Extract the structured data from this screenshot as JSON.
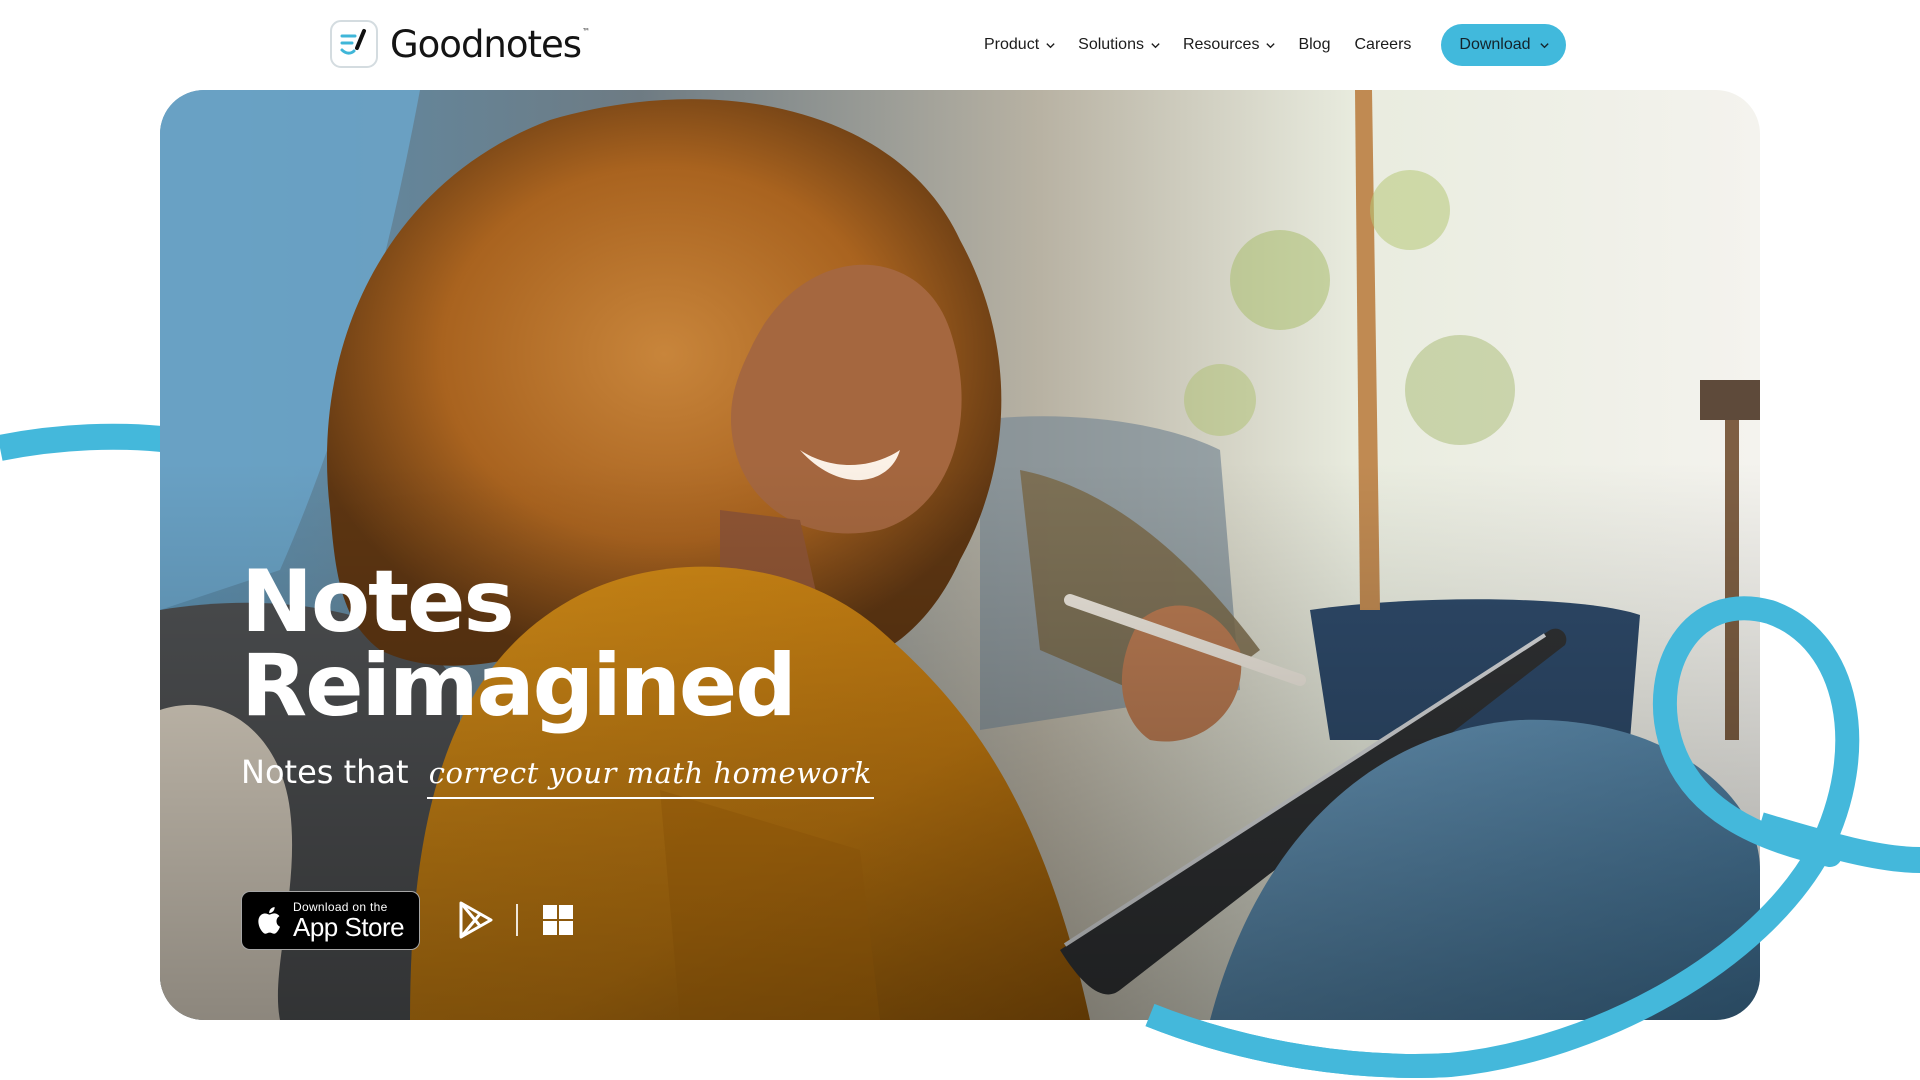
{
  "brand": {
    "name": "Goodnotes",
    "trademark": "™",
    "accent_color": "#41b9dc"
  },
  "nav": {
    "items": [
      {
        "label": "Product",
        "has_dropdown": true
      },
      {
        "label": "Solutions",
        "has_dropdown": true
      },
      {
        "label": "Resources",
        "has_dropdown": true
      },
      {
        "label": "Blog",
        "has_dropdown": false
      },
      {
        "label": "Careers",
        "has_dropdown": false
      }
    ],
    "download_label": "Download"
  },
  "hero": {
    "title_line1": "Notes",
    "title_line2": "Reimagined",
    "subtitle_prefix": "Notes that",
    "subtitle_handwritten": "correct your math homework",
    "app_store": {
      "small_text": "Download on the",
      "big_text": "App Store"
    },
    "icons": [
      "apple-icon",
      "google-play-icon",
      "windows-icon",
      "chevron-down-icon"
    ]
  }
}
